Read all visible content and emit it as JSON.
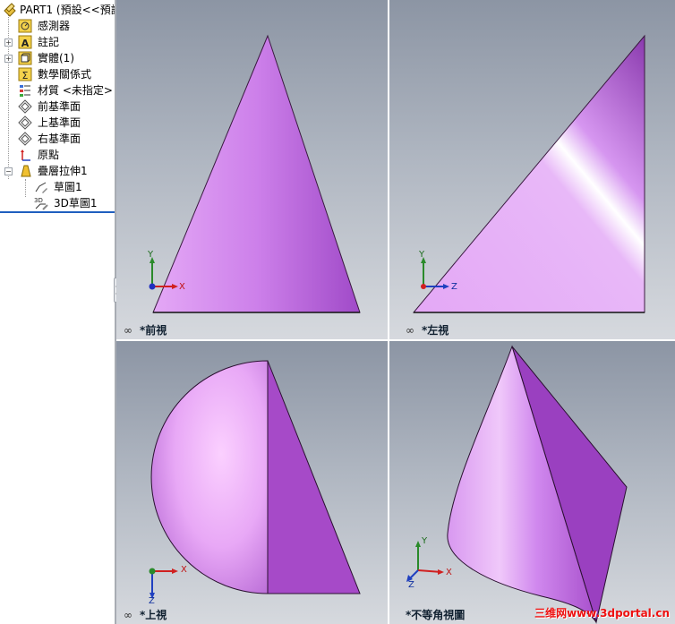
{
  "tree": {
    "part": "PART1 (預設<<預設>",
    "sensors": "感測器",
    "annotations": "註記",
    "solid_bodies": "實體(1)",
    "equations": "數學關係式",
    "material": "材質 <未指定>",
    "front_plane": "前基準面",
    "top_plane": "上基準面",
    "right_plane": "右基準面",
    "origin": "原點",
    "loft": "疊層拉伸1",
    "sketch1": "草圖1",
    "sketch3d": "3D草圖1"
  },
  "viewports": {
    "front": "*前視",
    "left": "*左視",
    "top": "*上視",
    "iso": "*不等角視圖"
  },
  "triad": {
    "x": "X",
    "y": "Y",
    "z": "Z"
  },
  "watermark": "三维网www.3dportal.cn",
  "colors": {
    "solid": "#d88ef0",
    "selection": "#1f5fbf"
  }
}
